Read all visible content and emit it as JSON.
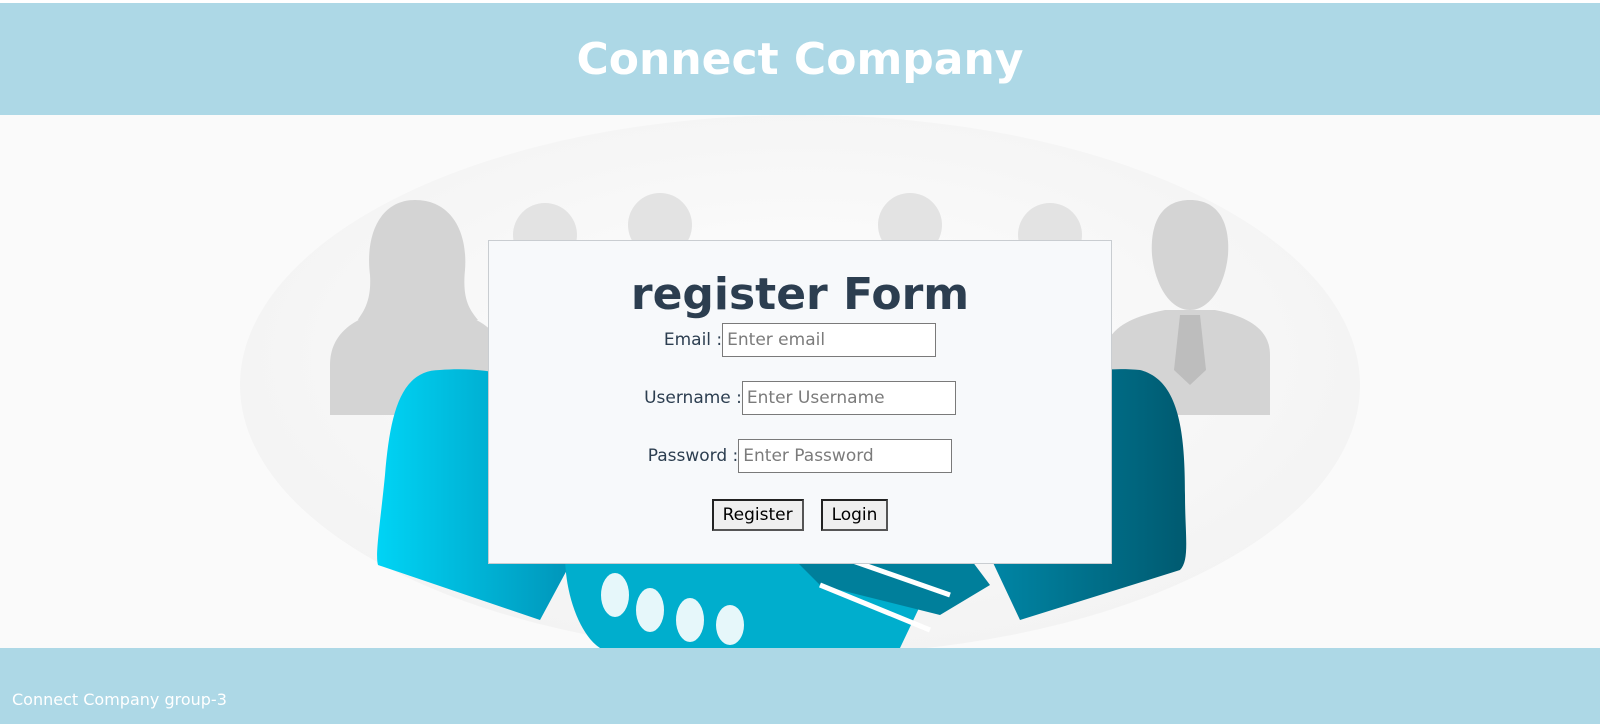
{
  "header": {
    "title": "Connect Company"
  },
  "form": {
    "title": "register Form",
    "email_label": "Email :",
    "email_placeholder": "Enter email",
    "email_value": "",
    "username_label": "Username :",
    "username_placeholder": "Enter Username",
    "username_value": "",
    "password_label": "Password :",
    "password_placeholder": "Enter Password",
    "password_value": "",
    "register_label": "Register",
    "login_label": "Login"
  },
  "footer": {
    "text": "Connect Company group-3"
  },
  "colors": {
    "header_bg": "#add8e6",
    "title_text": "#2c3e50",
    "hand_light": "#00c8ee",
    "hand_dark": "#006a80",
    "silhouette": "#d6d6d6"
  },
  "icons": {
    "hero_image": "business-people-handshake-image"
  }
}
